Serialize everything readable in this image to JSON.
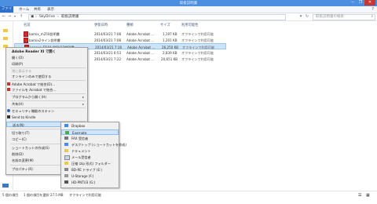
{
  "window": {
    "title": "取扱説明書",
    "min": "─",
    "max": "❐",
    "close": "✕"
  },
  "ribbon": {
    "file": "ファイル",
    "tabs": [
      "ホーム",
      "共有",
      "表示"
    ]
  },
  "address": {
    "path": [
      "SkyDrive",
      "取扱説明書"
    ],
    "search_placeholder": "取扱説明書の検索"
  },
  "columns": {
    "name": "名前",
    "date": "更新日時",
    "type": "種類",
    "size": "サイズ",
    "status": "利用可能性"
  },
  "files": [
    {
      "name": "bamix_m250説明書",
      "date": "2014/03/21 7:08",
      "type": "Adobe Acrobat ...",
      "size": "1,197 KB",
      "status": "オフラインで利用可能"
    },
    {
      "name": "bamix2ライン説明書",
      "date": "2014/03/21 7:08",
      "type": "Adobe Acrobat ...",
      "size": "1,201 KB",
      "status": "オフラインで利用可能"
    },
    {
      "name": "Lenovo_E540_MOH12説明書",
      "date": "2014/03/21 7:16",
      "type": "Adobe Acrobat ...",
      "size": "26,250 KB",
      "status": "オフラインで利用可能"
    },
    {
      "name": "",
      "date": "2014/03/21 6:53",
      "type": "Adobe Acrobat ...",
      "size": "2,839 KB",
      "status": "オフラインで利用可能"
    },
    {
      "name": "",
      "date": "2014/03/21 7:22",
      "type": "Adobe Acrobat ...",
      "size": "20,651 KB",
      "status": "オフラインで利用可能"
    }
  ],
  "context_menu": {
    "header": "Adobe Reader XI で開く",
    "items": {
      "open": "開く(O)",
      "print": "印刷(P)",
      "always_offline": "常に表示する",
      "online_only": "オンラインのみで使用する",
      "combine_acrobat": "Adobe Acrobat で結合(D)...",
      "combine_files": "ファイルを Acrobat で結合...",
      "open_with": "プログラムから開く(H)",
      "share": "共有(H)",
      "security": "セキュリティ機能のスキャン",
      "kindle": "Send to Kindle",
      "send_to": "送る(N)",
      "cut": "切り取り(T)",
      "copy": "コピー(C)",
      "shortcut": "ショートカットの作成(S)",
      "delete": "削除(D)",
      "rename": "名前の変更(M)",
      "properties": "プロパティ(R)"
    }
  },
  "send_to_menu": [
    {
      "label": "Dropbox",
      "icon": "dropbox-icon"
    },
    {
      "label": "Evernote",
      "icon": "evernote-icon"
    },
    {
      "label": "FAX 受信者",
      "icon": "fax-icon"
    },
    {
      "label": "デスクトップ (ショートカットを作成)",
      "icon": "desktop-icon"
    },
    {
      "label": "ドキュメント",
      "icon": "documents-icon"
    },
    {
      "label": "メール受信者",
      "icon": "mail-icon"
    },
    {
      "label": "圧縮 (zip 形式) フォルダー",
      "icon": "zip-folder-icon"
    },
    {
      "label": "BD-RE ドライブ (E:)",
      "icon": "bd-drive-icon"
    },
    {
      "label": "U-Storage (F:)",
      "icon": "usb-drive-icon"
    },
    {
      "label": "HD-PNTU3 (G:)",
      "icon": "hdd-icon"
    }
  ],
  "status": {
    "items": "5 個の項目",
    "selection": "1 個の項目を選択 27.5 MB",
    "offline": "オフラインで利用可能"
  },
  "colors": {
    "titlebar": "#4c8ee0",
    "file_tab": "#2d6fc9",
    "selection": "#cce4f9",
    "menu_bg": "#f0f0f0",
    "close": "#c7392f"
  }
}
